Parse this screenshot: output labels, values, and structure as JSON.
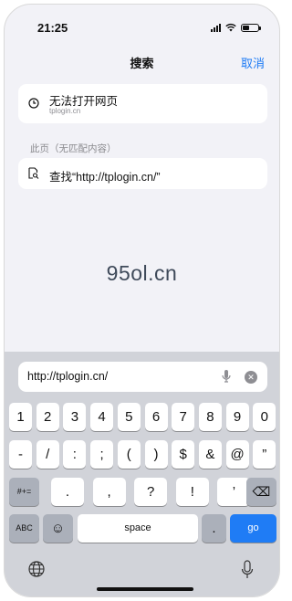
{
  "status": {
    "time": "21:25"
  },
  "nav": {
    "title": "搜索",
    "cancel": "取消"
  },
  "suggestion": {
    "title": "无法打开网页",
    "subtitle": "tplogin.cn"
  },
  "section": {
    "label": "此页（无匹配内容）"
  },
  "find": {
    "label": "查找“http://tplogin.cn/”"
  },
  "watermark": "95ol.cn",
  "url_bar": {
    "value": "http://tplogin.cn/",
    "clear": "✕"
  },
  "keyboard": {
    "row1": [
      "1",
      "2",
      "3",
      "4",
      "5",
      "6",
      "7",
      "8",
      "9",
      "0"
    ],
    "row2": [
      "-",
      "/",
      ":",
      ";",
      "(",
      ")",
      "$",
      "&",
      "@",
      "”"
    ],
    "row3": [
      ".",
      ",",
      "?",
      "!",
      "’"
    ],
    "symbols_toggle": "#+=",
    "backspace": "⌫",
    "abc": "ABC",
    "emoji": "☺",
    "space": "space",
    "period": ".",
    "go": "go"
  },
  "colors": {
    "accent": "#1f7cf5",
    "keyboard_bg": "#d1d3d9",
    "page_bg": "#f2f2f7"
  }
}
